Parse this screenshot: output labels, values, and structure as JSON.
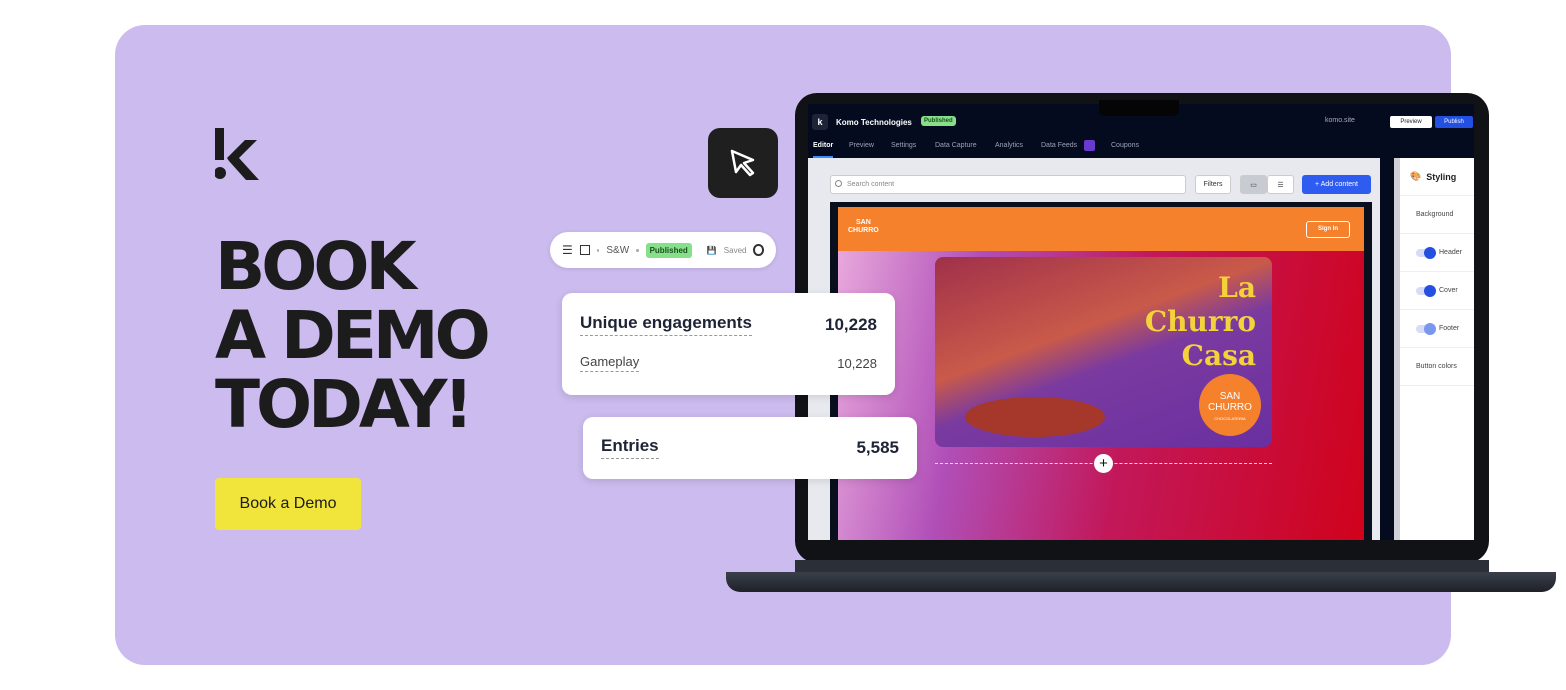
{
  "brand": {
    "logo_text": "k"
  },
  "hero": {
    "lines": [
      "BOOK",
      "A DEMO",
      "TODAY!"
    ],
    "cta": "Book a Demo"
  },
  "toolbar_pill": {
    "project": "S&W",
    "status": "Published",
    "saved": "Saved"
  },
  "stats": {
    "unique_label": "Unique engagements",
    "unique_value": "10,228",
    "gameplay_label": "Gameplay",
    "gameplay_value": "10,228",
    "entries_label": "Entries",
    "entries_value": "5,585"
  },
  "app": {
    "title": "Komo Technologies",
    "status": "Published",
    "domain": "komo.site",
    "preview": "Preview",
    "publish": "Publish",
    "tabs": [
      "Editor",
      "Preview",
      "Settings",
      "Data Capture",
      "Analytics",
      "Data Feeds",
      "Coupons"
    ],
    "search_placeholder": "Search content",
    "filters": "Filters",
    "add_content": "Add content",
    "site": {
      "logo_line1": "SAN",
      "logo_line2": "CHURRO",
      "sign_in": "Sign In",
      "banner_title1": "La Churro",
      "banner_title2": "Casa",
      "badge1": "SAN",
      "badge2": "CHURRO",
      "badge3": "CHOCOLATERIA"
    },
    "panel": {
      "title": "Styling",
      "background": "Background",
      "header": "Header",
      "cover": "Cover",
      "footer": "Footer",
      "button_colors": "Button colors"
    }
  },
  "colors": {
    "card": "#cbbbee",
    "cta": "#f1e43a",
    "accent": "#2350e0",
    "site_header": "#f5812c"
  }
}
